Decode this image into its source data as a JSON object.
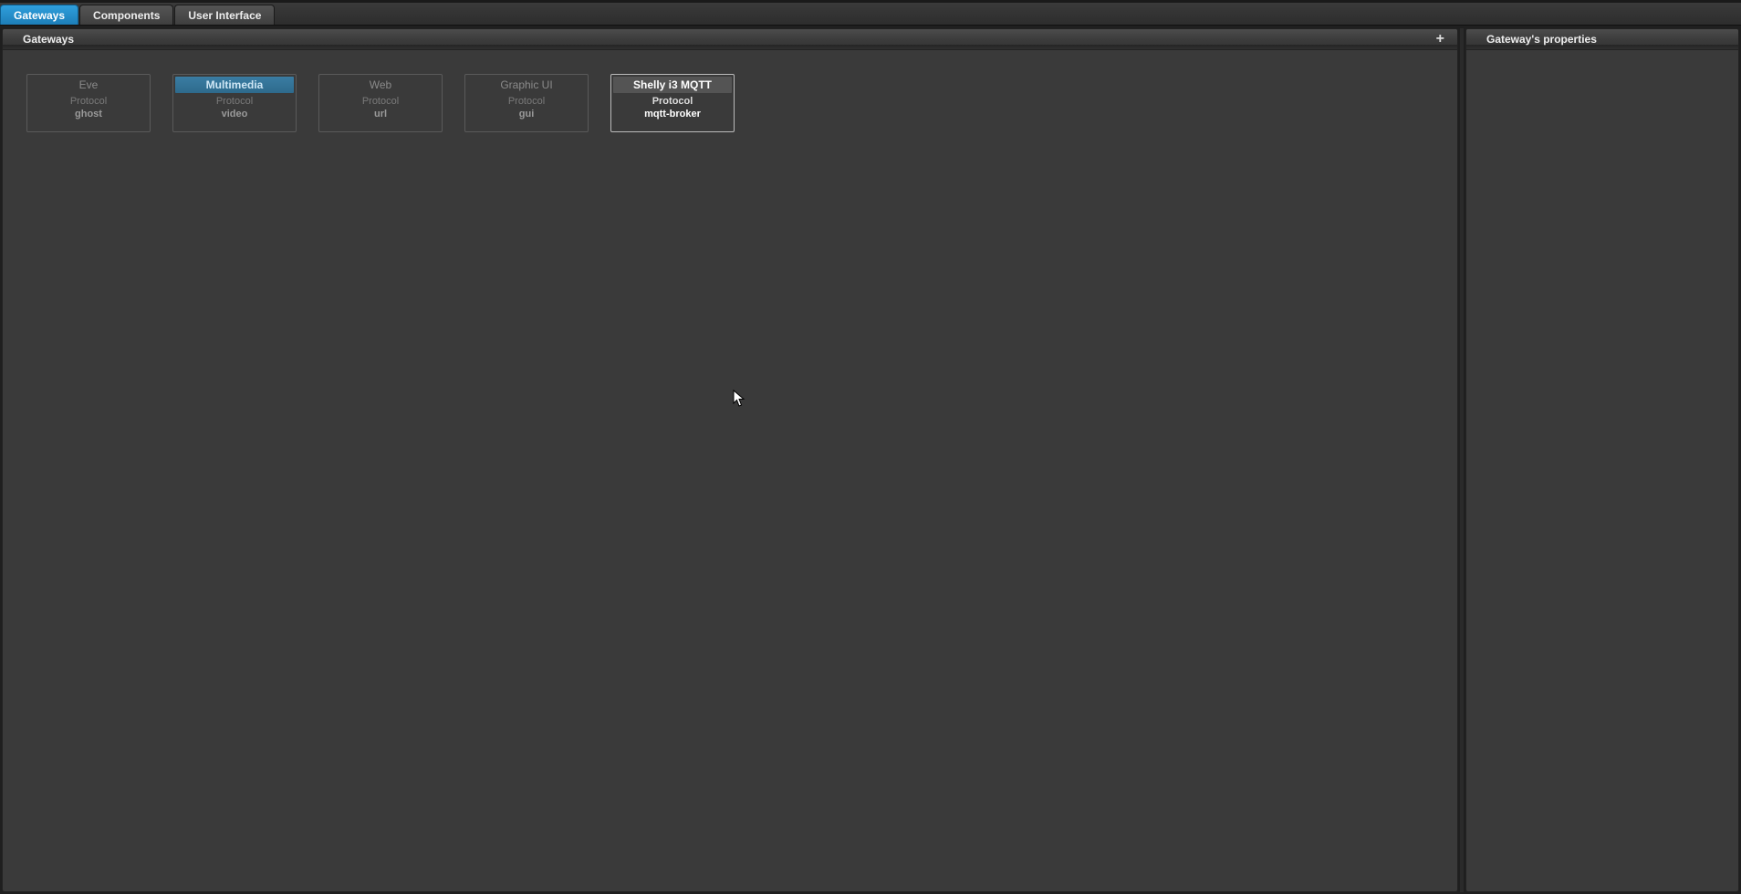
{
  "tabs": [
    {
      "label": "Gateways",
      "active": true
    },
    {
      "label": "Components",
      "active": false
    },
    {
      "label": "User Interface",
      "active": false
    }
  ],
  "main_panel": {
    "title": "Gateways"
  },
  "properties_panel": {
    "title": "Gateway's properties"
  },
  "protocol_label": "Protocol",
  "gateways": [
    {
      "name": "Eve",
      "protocol": "ghost",
      "highlight": false,
      "selected": false
    },
    {
      "name": "Multimedia",
      "protocol": "video",
      "highlight": true,
      "selected": false
    },
    {
      "name": "Web",
      "protocol": "url",
      "highlight": false,
      "selected": false
    },
    {
      "name": "Graphic UI",
      "protocol": "gui",
      "highlight": false,
      "selected": false
    },
    {
      "name": "Shelly i3 MQTT",
      "protocol": "mqtt-broker",
      "highlight": false,
      "selected": true
    }
  ]
}
